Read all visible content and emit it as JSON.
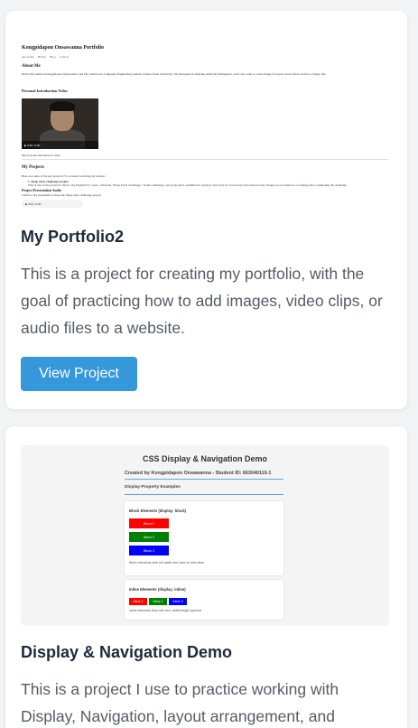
{
  "colors": {
    "accent": "#3498db",
    "title": "#1f2a3a",
    "text": "#555c66",
    "red": "#ff0000",
    "green": "#008000",
    "blue": "#0000ff"
  },
  "projects": [
    {
      "title": "My Portfolio2",
      "description": "This is a project for creating my portfolio, with the goal of practicing how to add images, video clips, or audio files to a website.",
      "button_label": "View Project",
      "preview": {
        "heading": "Kongpidapon Onsawanna Portfolio",
        "nav": [
          "About Me",
          "Hobby",
          "Blog",
          "Contact"
        ],
        "about_heading": "About Me",
        "about_text": "Hello! My name is Kongpidapon Onsawanna, and I'm a third-year Computer Engineering student at Khon Kaen University. I'm interested in studying Artificial intelligence, and I also want to create things I've never done before and live a happy life.",
        "video_heading": "Personal Introduction Video",
        "video_time": "0:00 / 0:00",
        "video_caption": "My personal introduction video",
        "projects_heading": "My Projects",
        "projects_text": "Here are some of the key projects I've worked on during my studies:",
        "project_item_title": "1. Sleep early challenge project",
        "project_item_text": "This is one of the projects I did for my English IV course, called the \"Sleep Early Challenge.\" In this challenge, our group and I committed to going to bed early for seven days and observed any changes in our behavior or feelings after completing the challenge.",
        "audio_heading": "Project Presentation Audio",
        "audio_text": "Listen to my presentation about the Sleep early challenge project",
        "audio_time": "0:00 / 0:00"
      }
    },
    {
      "title": "Display & Navigation Demo",
      "description": "This is a project I use to practice working with Display, Navigation, layout arrangement, and",
      "preview": {
        "heading": "CSS Display & Navigation Demo",
        "subheading": "Created by Kongpidapon Onsawanna - Student ID: 663040110-1",
        "section": "Display Property Examples",
        "block_label": "Block Elements (display: block)",
        "blocks": [
          "Block 1",
          "Block 2",
          "Block 3"
        ],
        "block_note": "Block elements take full width and start on new lines",
        "inline_label": "Inline Elements (display: inline)",
        "inlines": [
          "Inline 1",
          "Inline 2",
          "Inline 3"
        ],
        "inline_note": "Inline elements flow with text, width/height ignored"
      }
    }
  ]
}
